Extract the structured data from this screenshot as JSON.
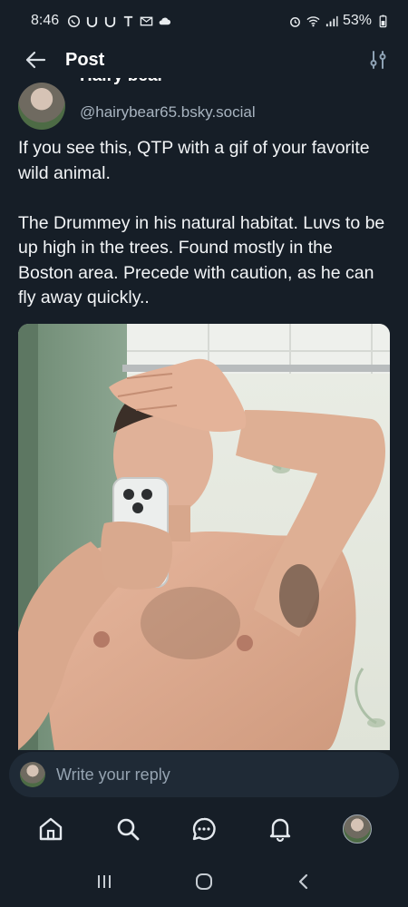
{
  "status_bar": {
    "time": "8:46",
    "battery": "53%"
  },
  "header": {
    "title": "Post"
  },
  "post": {
    "author_name": "Hairy bear",
    "author_handle": "@hairybear65.bsky.social",
    "text": "If you see this, QTP with a gif of your favorite wild animal.\n\nThe Drummey in his natural habitat. Luvs to be up high in the trees.  Found mostly in the Boston area.  Precede with caution,  as he can fly away quickly.."
  },
  "reply": {
    "placeholder": "Write your reply"
  },
  "nav": {
    "items": [
      "home-icon",
      "search-icon",
      "chat-icon",
      "notifications-icon",
      "profile-avatar"
    ]
  },
  "colors": {
    "background": "#161e27",
    "reply_bar": "#1f2a36",
    "handle": "#a8b4c0"
  }
}
